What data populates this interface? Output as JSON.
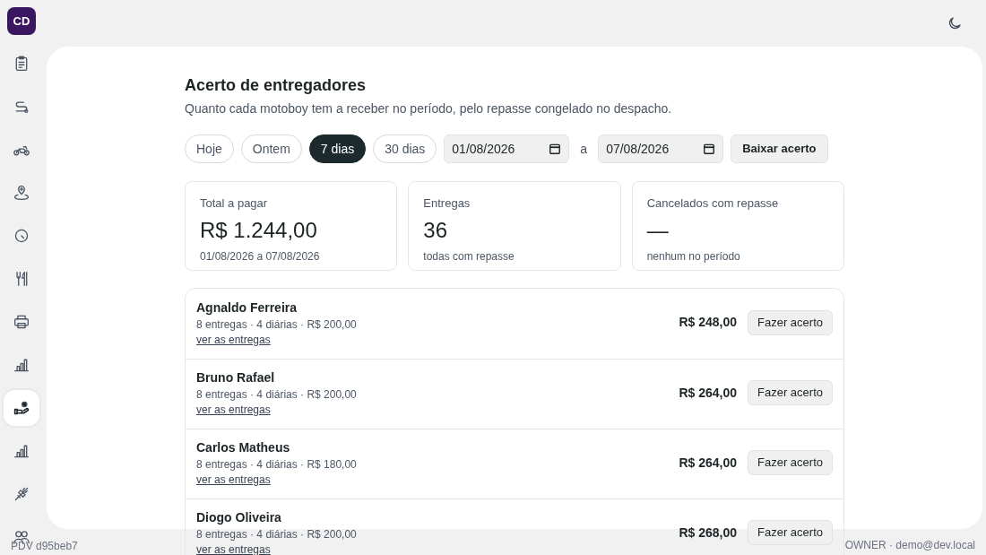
{
  "logo": {
    "text": "CD"
  },
  "sidebar": {
    "items": [
      {
        "selected": false
      },
      {
        "selected": false
      },
      {
        "selected": false
      },
      {
        "selected": false
      },
      {
        "selected": false
      },
      {
        "selected": false
      },
      {
        "selected": false
      },
      {
        "selected": false
      },
      {
        "selected": true
      },
      {
        "selected": false
      },
      {
        "selected": false
      },
      {
        "selected": false
      }
    ]
  },
  "header": {
    "title": "Acerto de entregadores",
    "subtitle": "Quanto cada motoboy tem a receber no período, pelo repasse congelado no despacho."
  },
  "ranges": [
    {
      "label": "Hoje",
      "selected": false
    },
    {
      "label": "Ontem",
      "selected": false
    },
    {
      "label": "7 dias",
      "selected": true
    },
    {
      "label": "30 dias",
      "selected": false
    }
  ],
  "date_from": {
    "value": "01/08/2026"
  },
  "date_separator": "a",
  "date_to": {
    "value": "07/08/2026"
  },
  "download_button": "Baixar acerto",
  "cards": [
    {
      "label": "Total a pagar",
      "value": "R$ 1.244,00",
      "note": "01/08/2026 a 07/08/2026"
    },
    {
      "label": "Entregas",
      "value": "36",
      "note": "todas com repasse"
    },
    {
      "label": "Cancelados com repasse",
      "value": "—",
      "note": "nenhum no período"
    }
  ],
  "couriers": [
    {
      "name": "Agnaldo Ferreira",
      "details": "8 entregas · 4 diárias · R$ 200,00",
      "link": "ver as entregas",
      "amount": "R$ 248,00",
      "action": "Fazer acerto"
    },
    {
      "name": "Bruno Rafael",
      "details": "8 entregas · 4 diárias · R$ 200,00",
      "link": "ver as entregas",
      "amount": "R$ 264,00",
      "action": "Fazer acerto"
    },
    {
      "name": "Carlos Matheus",
      "details": "8 entregas · 4 diárias · R$ 180,00",
      "link": "ver as entregas",
      "amount": "R$ 264,00",
      "action": "Fazer acerto"
    },
    {
      "name": "Diogo Oliveira",
      "details": "8 entregas · 4 diárias · R$ 200,00",
      "link": "ver as entregas",
      "amount": "R$ 268,00",
      "action": "Fazer acerto"
    }
  ],
  "footer": {
    "version": "PDV d95beb7",
    "user": "OWNER · demo@dev.local"
  }
}
